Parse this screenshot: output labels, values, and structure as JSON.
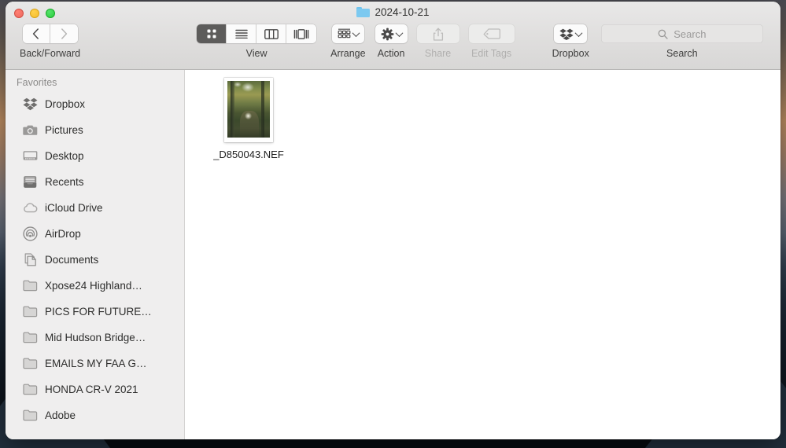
{
  "window": {
    "title": "2024-10-21",
    "title_icon": "blue-folder-icon",
    "traffic_lights": [
      {
        "name": "close-button",
        "color": "#ec6a5f"
      },
      {
        "name": "minimize-button",
        "color": "#f5bd2f"
      },
      {
        "name": "zoom-button",
        "color": "#2bcc3e"
      }
    ]
  },
  "toolbar": {
    "nav": {
      "label": "Back/Forward",
      "back_icon": "chevron-left-icon",
      "forward_icon": "chevron-right-icon"
    },
    "view": {
      "label": "View",
      "options": [
        {
          "name": "icon-view",
          "icon": "grid-icon",
          "selected": true
        },
        {
          "name": "list-view",
          "icon": "list-icon",
          "selected": false
        },
        {
          "name": "column-view",
          "icon": "columns-icon",
          "selected": false
        },
        {
          "name": "gallery-view",
          "icon": "gallery-icon",
          "selected": false
        }
      ]
    },
    "arrange": {
      "label": "Arrange",
      "icon": "arrange-grid-icon",
      "has_chevron": true,
      "disabled": false
    },
    "action": {
      "label": "Action",
      "icon": "gear-icon",
      "has_chevron": true,
      "disabled": false
    },
    "share": {
      "label": "Share",
      "icon": "share-icon",
      "has_chevron": false,
      "disabled": true
    },
    "edit_tags": {
      "label": "Edit Tags",
      "icon": "tag-icon",
      "has_chevron": false,
      "disabled": true
    },
    "dropbox": {
      "label": "Dropbox",
      "icon": "dropbox-icon",
      "has_chevron": true,
      "disabled": false
    },
    "search": {
      "label": "Search",
      "placeholder": "Search",
      "value": "",
      "icon": "search-icon"
    }
  },
  "sidebar": {
    "section_title": "Favorites",
    "items": [
      {
        "label": "Dropbox",
        "icon": "dropbox-icon"
      },
      {
        "label": "Pictures",
        "icon": "camera-icon"
      },
      {
        "label": "Desktop",
        "icon": "desktop-icon"
      },
      {
        "label": "Recents",
        "icon": "recents-clock-icon"
      },
      {
        "label": "iCloud Drive",
        "icon": "cloud-icon"
      },
      {
        "label": "AirDrop",
        "icon": "airdrop-icon"
      },
      {
        "label": "Documents",
        "icon": "documents-icon"
      },
      {
        "label": "Xpose24 Highland…",
        "icon": "folder-icon"
      },
      {
        "label": "PICS FOR FUTURE…",
        "icon": "folder-icon"
      },
      {
        "label": "Mid Hudson Bridge…",
        "icon": "folder-icon"
      },
      {
        "label": "EMAILS MY FAA G…",
        "icon": "folder-icon"
      },
      {
        "label": "HONDA CR-V 2021",
        "icon": "folder-icon"
      },
      {
        "label": "Adobe",
        "icon": "folder-icon"
      }
    ]
  },
  "content": {
    "files": [
      {
        "name": "_D850043.NEF",
        "thumbnail": "forest-path-photo-thumbnail"
      }
    ]
  },
  "colors": {
    "toolbar_bg": "#e2e1e0",
    "sidebar_bg": "#efeeee",
    "content_bg": "#ffffff",
    "title_folder": "#7cc9f0",
    "selected_segment": "#5d5c5b"
  }
}
